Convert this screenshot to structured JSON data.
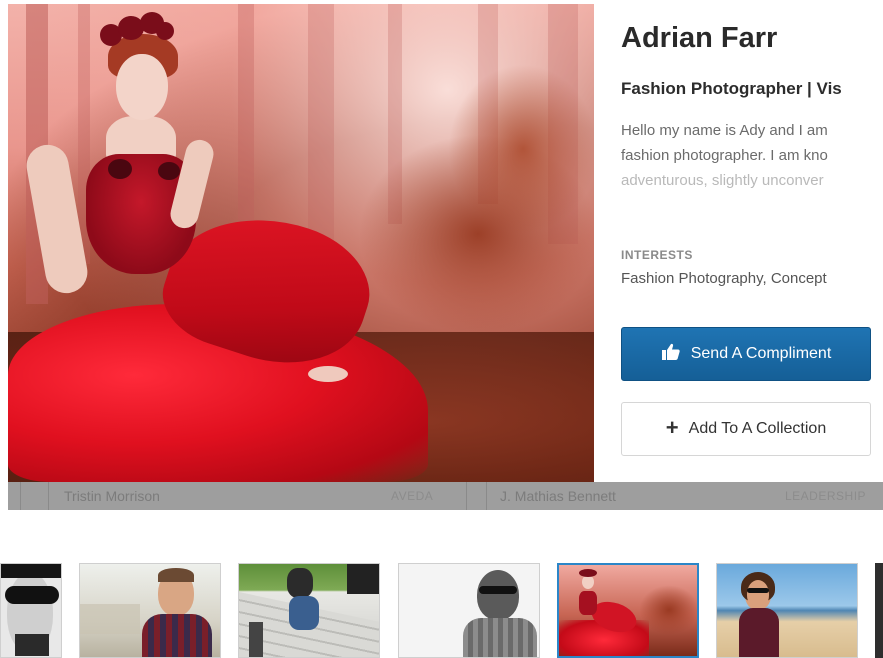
{
  "profile": {
    "name": "Adrian Farr",
    "title": "Fashion Photographer | Vis",
    "bio_lines": [
      "Hello my name is Ady and I am",
      "fashion photographer. I am kno",
      "adventurous, slightly unconver"
    ],
    "interests_label": "INTERESTS",
    "interests_value": "Fashion Photography, Concept"
  },
  "actions": {
    "compliment_label": "Send A Compliment",
    "compliment_icon": "thumbs-up-icon",
    "collection_label": "Add To A Collection",
    "collection_icon": "plus-icon",
    "accent_color": "#1a6aa8"
  },
  "strip": {
    "items": [
      {
        "name": "Tristin Morrison",
        "tag": "AVEDA"
      },
      {
        "name": "J. Mathias Bennett",
        "tag": "LEADERSHIP"
      }
    ]
  },
  "thumbnails": [
    {
      "label": "profile-thumb-1",
      "active": false
    },
    {
      "label": "profile-thumb-2",
      "active": false
    },
    {
      "label": "profile-thumb-3",
      "active": false
    },
    {
      "label": "profile-thumb-4",
      "active": false
    },
    {
      "label": "profile-thumb-5",
      "active": true
    },
    {
      "label": "profile-thumb-6",
      "active": false
    }
  ]
}
